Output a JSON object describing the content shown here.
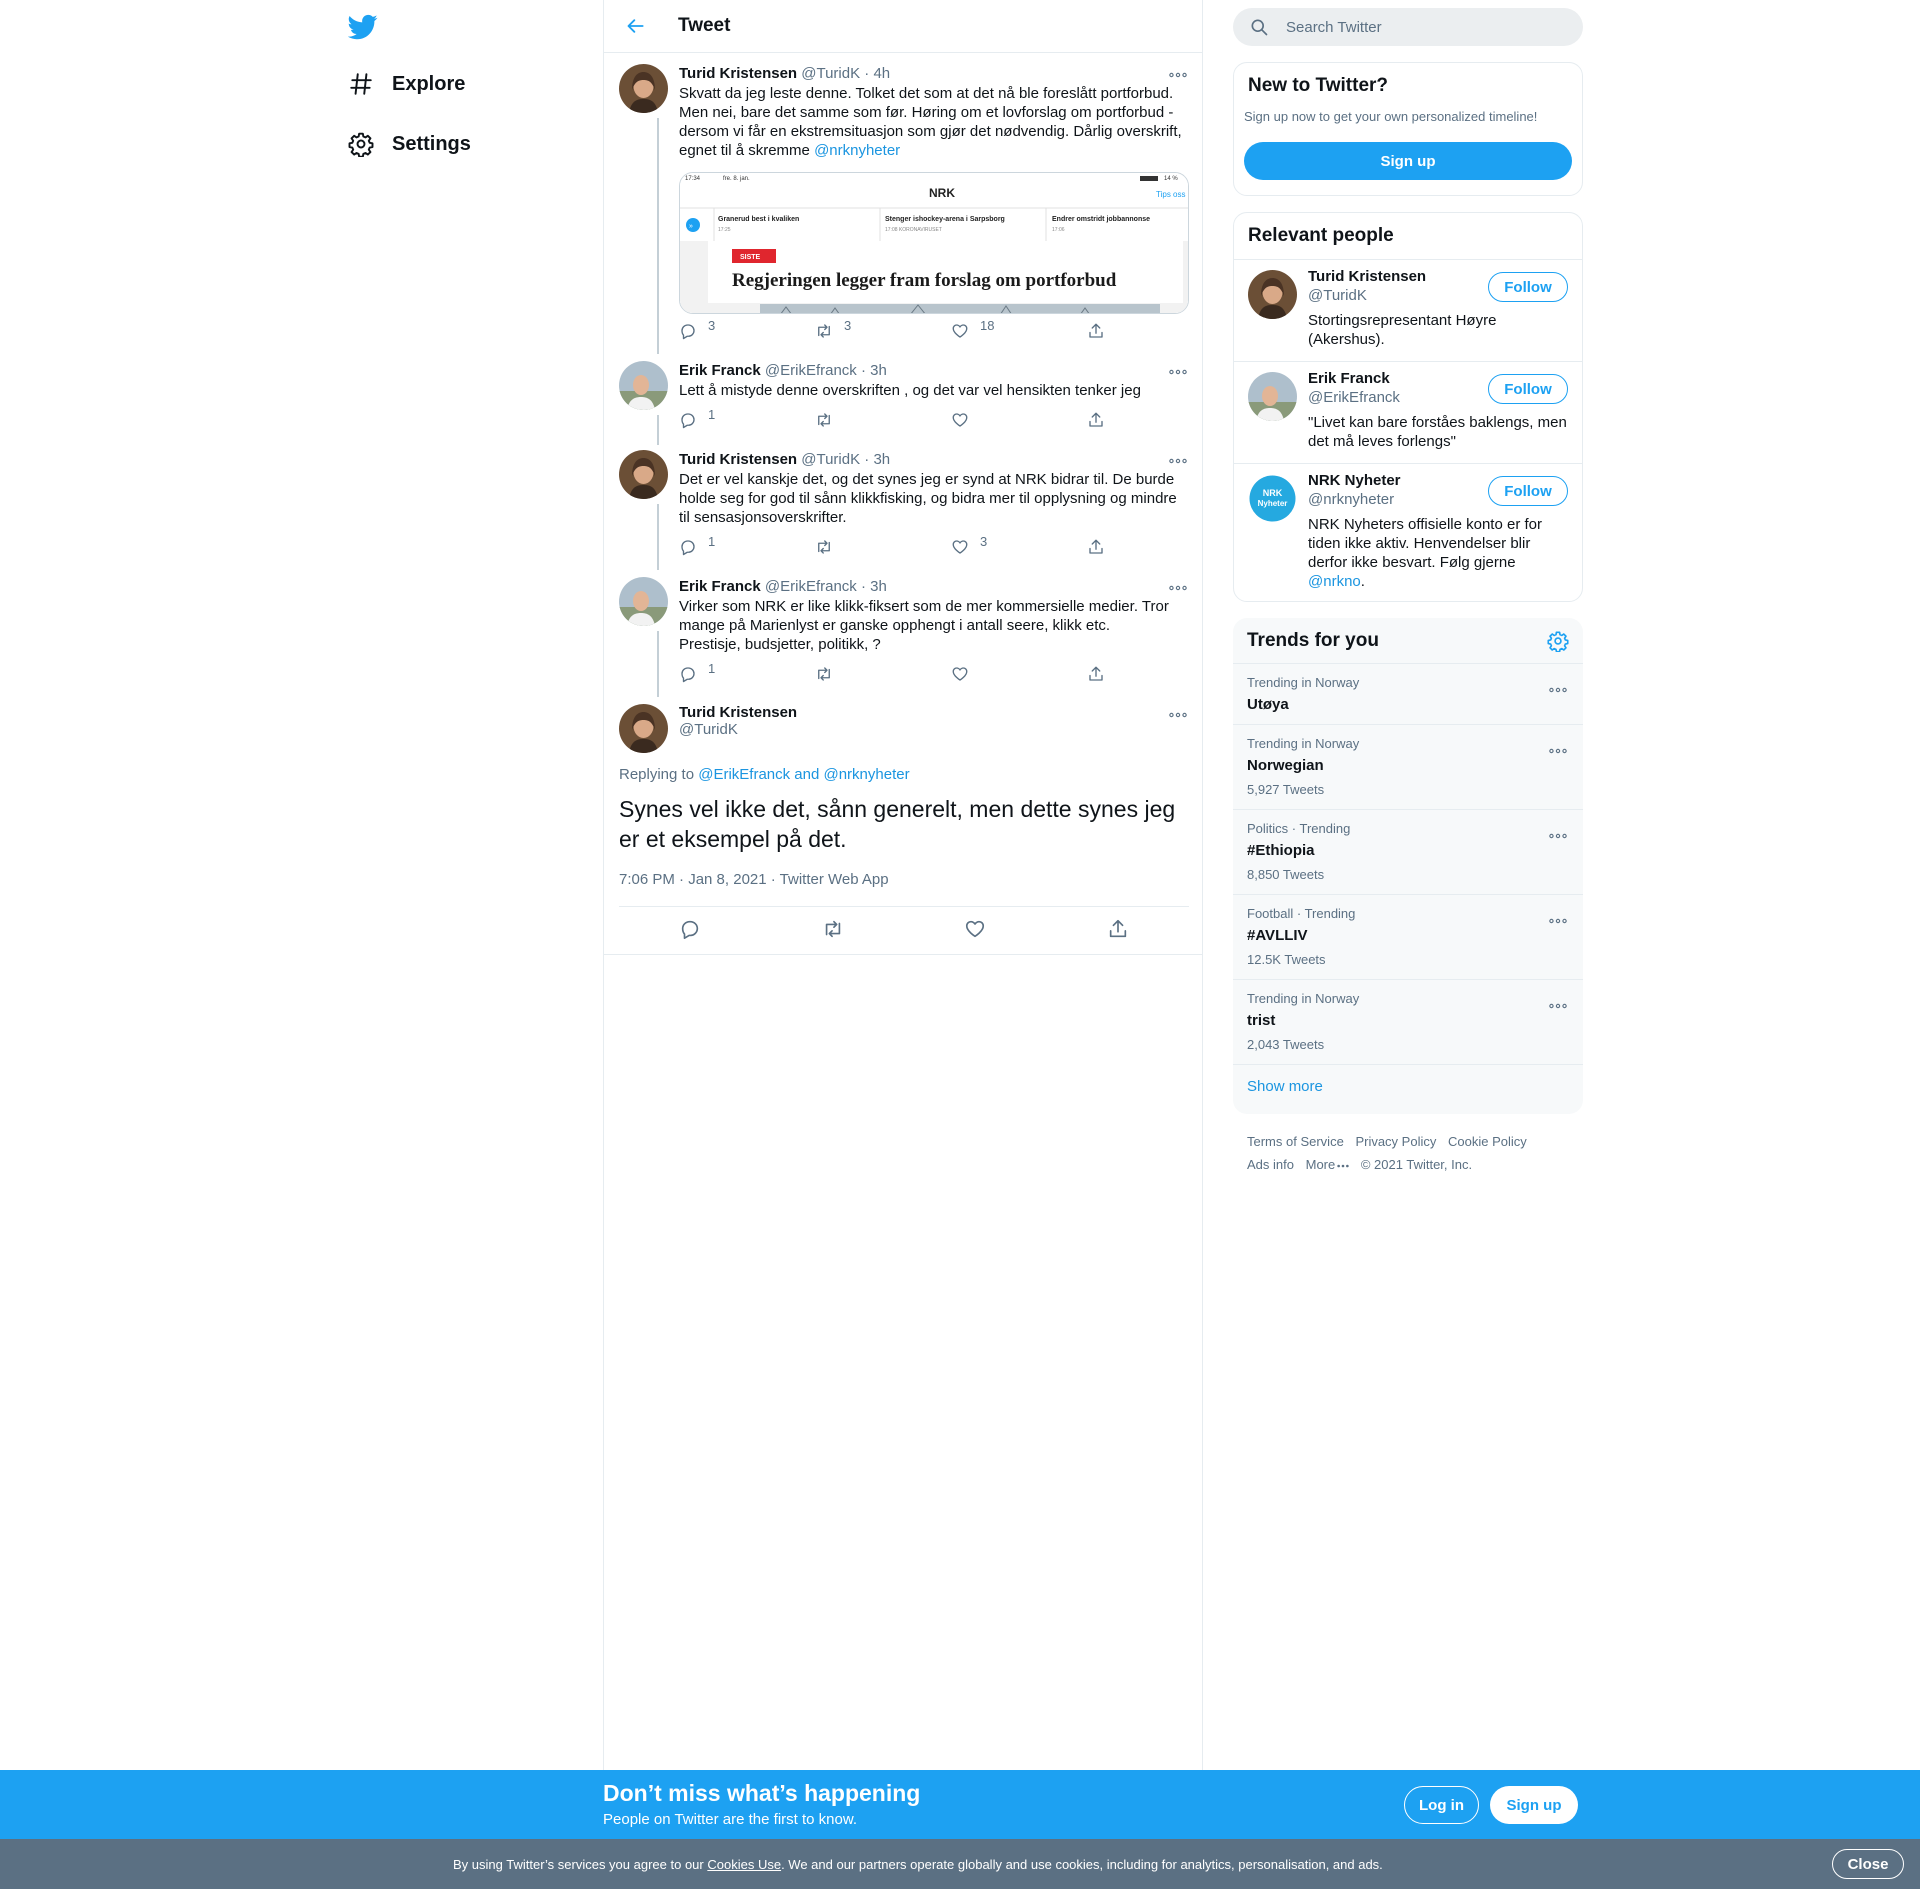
{
  "nav": {
    "logo_icon": "twitter-bird-icon",
    "items": [
      {
        "label": "Explore",
        "icon": "hashtag-icon"
      },
      {
        "label": "Settings",
        "icon": "gear-icon"
      }
    ]
  },
  "header": {
    "title": "Tweet"
  },
  "thread": [
    {
      "name": "Turid Kristensen",
      "handle": "@TuridK",
      "time": "· 4h",
      "text": "Skvatt da jeg leste denne. Tolket det som at det nå ble foreslått portforbud. Men nei, bare det samme som før. Høring om et lovforslag om portforbud - dersom vi får en ekstremsituasjon som gjør det nødvendig. Dårlig overskrift, egnet til å skremme ",
      "mention": "@nrknyheter",
      "replies": "3",
      "retweets": "3",
      "likes": "18",
      "embed": {
        "status_time": "17:34",
        "status_date": "fre. 8. jan.",
        "status_right": "14 %",
        "brand": "NRK",
        "tips": "Tips oss",
        "nav_items": [
          {
            "title": "Granerud best i kvaliken",
            "sub": "17:25"
          },
          {
            "title": "Stenger ishockey-arena i Sarpsborg",
            "sub": "17:08  KORONAVIRUSET"
          },
          {
            "title": "Endrer omstridt jobbannonse",
            "sub": "17:06"
          }
        ],
        "badge": "SISTE",
        "headline": "Regjeringen legger fram forslag om portforbud"
      }
    },
    {
      "name": "Erik Franck",
      "handle": "@ErikEfranck",
      "time": "· 3h",
      "text": "Lett å mistyde denne overskriften , og det var vel hensikten tenker jeg",
      "replies": "1",
      "retweets": "",
      "likes": ""
    },
    {
      "name": "Turid Kristensen",
      "handle": "@TuridK",
      "time": "· 3h",
      "text": "Det er vel kanskje det, og det synes jeg er synd at NRK bidrar til. De burde holde seg for god til sånn klikkfisking, og bidra mer til opplysning og mindre til sensasjonsoverskrifter.",
      "replies": "1",
      "retweets": "",
      "likes": "3"
    },
    {
      "name": "Erik Franck",
      "handle": "@ErikEfranck",
      "time": "· 3h",
      "text": "Virker som NRK er  like klikk-fiksert som de mer kommersielle medier. Tror mange  på Marienlyst er ganske opphengt i antall seere, klikk etc.\n Prestisje, budsjetter, politikk, ?",
      "replies": "1",
      "retweets": "",
      "likes": ""
    }
  ],
  "main": {
    "name": "Turid Kristensen",
    "handle": "@TuridK",
    "replying_prefix": "Replying to ",
    "replying_to": "@ErikEfranck and @nrknyheter",
    "text": "Synes vel ikke det, sånn generelt, men dette synes jeg er et eksempel på det.",
    "meta": "7:06 PM · Jan 8, 2021 · Twitter Web App"
  },
  "search": {
    "placeholder": "Search Twitter"
  },
  "new_to_twitter": {
    "title": "New to Twitter?",
    "subtitle": "Sign up now to get your own personalized timeline!",
    "button": "Sign up"
  },
  "relevant_people": {
    "title": "Relevant people",
    "people": [
      {
        "name": "Turid Kristensen",
        "handle": "@TuridK",
        "bio": "Stortingsrepresentant Høyre (Akershus).",
        "button": "Follow"
      },
      {
        "name": "Erik Franck",
        "handle": "@ErikEfranck",
        "bio": "\"Livet kan bare forståes baklengs, men det må leves forlengs\"",
        "button": "Follow"
      },
      {
        "name": "NRK Nyheter",
        "handle": "@nrknyheter",
        "bio": "NRK Nyheters offisielle konto er for tiden ikke aktiv. Henvendelser blir derfor ikke besvart. Følg gjerne ",
        "bio_link": "@nrkno",
        "bio_end": ".",
        "button": "Follow",
        "avatar_text_1": "NRK",
        "avatar_text_2": "Nyheter"
      }
    ]
  },
  "trends": {
    "title": "Trends for you",
    "items": [
      {
        "context": "Trending in Norway",
        "title": "Utøya",
        "count": ""
      },
      {
        "context": "Trending in Norway",
        "title": "Norwegian",
        "count": "5,927 Tweets"
      },
      {
        "context": "Politics · Trending",
        "title": "#Ethiopia",
        "count": "8,850 Tweets"
      },
      {
        "context": "Football · Trending",
        "title": "#AVLLIV",
        "count": "12.5K Tweets"
      },
      {
        "context": "Trending in Norway",
        "title": "trist",
        "count": "2,043 Tweets"
      }
    ],
    "show_more": "Show more"
  },
  "footer": {
    "links": [
      "Terms of Service",
      "Privacy Policy",
      "Cookie Policy",
      "Ads info",
      "More"
    ],
    "copyright": "© 2021 Twitter, Inc."
  },
  "banner": {
    "title": "Don’t miss what’s happening",
    "subtitle": "People on Twitter are the first to know.",
    "login": "Log in",
    "signup": "Sign up"
  },
  "cookie": {
    "before": "By using Twitter’s services you agree to our ",
    "link": "Cookies Use",
    "after": ". We and our partners operate globally and use cookies, including for analytics, personalisation, and ads.",
    "close": "Close"
  },
  "colors": {
    "accent": "#1da1f2",
    "link": "#1b95e0",
    "secondary_text": "#5b7083",
    "cookie_bar": "#5b7083",
    "siste_red": "#e0262e"
  }
}
